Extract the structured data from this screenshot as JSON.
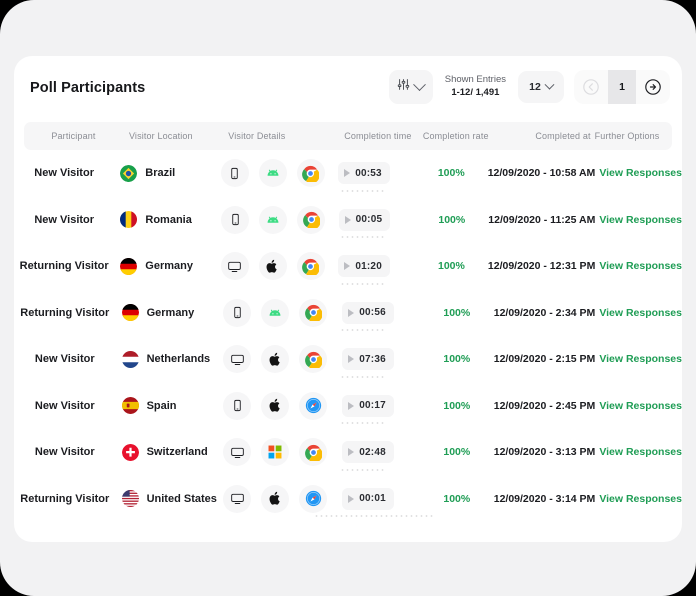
{
  "card": {
    "title": "Poll Participants"
  },
  "toolbar": {
    "filter_icon": "sliders-icon",
    "filter_chevron_icon": "chevron-down-icon",
    "shown_entries_label": "Shown Entries",
    "shown_entries_range": "1-12/ 1,491",
    "per_page_value": "12",
    "per_page_chevron_icon": "chevron-down-icon",
    "prev_page_icon": "circle-arrow-left-icon",
    "current_page": "1",
    "next_page_icon": "circle-arrow-right-icon"
  },
  "table": {
    "columns": [
      "Participant",
      "Visitor Location",
      "Visitor Details",
      "Completion time",
      "Completion rate",
      "Completed at",
      "Further Options"
    ],
    "view_responses_label": "View Responses",
    "rows": [
      {
        "participant": "New Visitor",
        "country": "Brazil",
        "flag": "brazil-flag-icon",
        "device": "mobile-icon",
        "os": "android-icon",
        "browser": "chrome-icon",
        "completion_time": "00:53",
        "completion_rate": "100%",
        "completed_at": "12/09/2020 - 10:58 AM"
      },
      {
        "participant": "New Visitor",
        "country": "Romania",
        "flag": "romania-flag-icon",
        "device": "mobile-icon",
        "os": "android-icon",
        "browser": "chrome-icon",
        "completion_time": "00:05",
        "completion_rate": "100%",
        "completed_at": "12/09/2020 - 11:25 AM"
      },
      {
        "participant": "Returning Visitor",
        "country": "Germany",
        "flag": "germany-flag-icon",
        "device": "desktop-icon",
        "os": "apple-icon",
        "browser": "chrome-icon",
        "completion_time": "01:20",
        "completion_rate": "100%",
        "completed_at": "12/09/2020 - 12:31 PM"
      },
      {
        "participant": "Returning Visitor",
        "country": "Germany",
        "flag": "germany-flag-icon",
        "device": "mobile-icon",
        "os": "android-icon",
        "browser": "chrome-icon",
        "completion_time": "00:56",
        "completion_rate": "100%",
        "completed_at": "12/09/2020 - 2:34 PM"
      },
      {
        "participant": "New Visitor",
        "country": "Netherlands",
        "flag": "netherlands-flag-icon",
        "device": "desktop-icon",
        "os": "apple-icon",
        "browser": "chrome-icon",
        "completion_time": "07:36",
        "completion_rate": "100%",
        "completed_at": "12/09/2020 - 2:15 PM"
      },
      {
        "participant": "New Visitor",
        "country": "Spain",
        "flag": "spain-flag-icon",
        "device": "mobile-icon",
        "os": "apple-icon",
        "browser": "safari-icon",
        "completion_time": "00:17",
        "completion_rate": "100%",
        "completed_at": "12/09/2020 - 2:45 PM"
      },
      {
        "participant": "New Visitor",
        "country": "Switzerland",
        "flag": "switzerland-flag-icon",
        "device": "desktop-icon",
        "os": "windows-icon",
        "browser": "chrome-icon",
        "completion_time": "02:48",
        "completion_rate": "100%",
        "completed_at": "12/09/2020 - 3:13 PM"
      },
      {
        "participant": "Returning Visitor",
        "country": "United States",
        "flag": "united-states-flag-icon",
        "device": "desktop-icon",
        "os": "apple-icon",
        "browser": "safari-icon",
        "completion_time": "00:01",
        "completion_rate": "100%",
        "completed_at": "12/09/2020 - 3:14 PM"
      }
    ]
  },
  "colors": {
    "accent_green": "#1f9d55",
    "page_bg": "#f2f2f3",
    "card_bg": "#ffffff",
    "muted_text": "#8b8d94"
  }
}
